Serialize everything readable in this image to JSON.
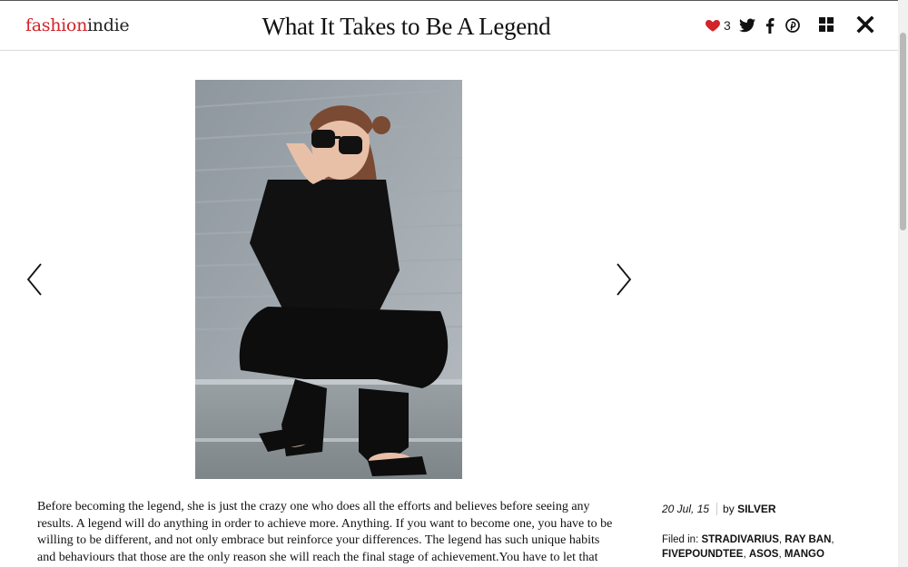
{
  "header": {
    "logo_part1": "fashion",
    "logo_part2": "indie",
    "title": "What It Takes to Be A Legend",
    "like_count": "3"
  },
  "icons": {
    "heart": "heart-icon",
    "twitter": "twitter-icon",
    "facebook": "facebook-icon",
    "pinterest": "pinterest-icon",
    "grid": "grid-icon",
    "close": "close-icon",
    "prev": "chevron-left-icon",
    "next": "chevron-right-icon"
  },
  "colors": {
    "brand_red": "#d2232a",
    "text": "#111111",
    "background": "#ffffff"
  },
  "article": {
    "body": "Before becoming the legend, she is just the crazy one who does all the efforts and believes before seeing any results. A legend will do anything in order to achieve more. Anything. If you want to become one, you have to be willing to be different, and not only embrace but reinforce your differences. The legend has such unique habits and behaviours that those are the only reason she will reach the final stage of achievement.You have to let that craziness alienate people, you"
  },
  "meta": {
    "date": "20 Jul, 15",
    "by_label": "by",
    "author": "SILVER",
    "filed_label": "Filed in:",
    "tags": [
      "STRADIVARIUS",
      "RAY BAN",
      "FIVEPOUNDTEE",
      "ASOS",
      "MANGO"
    ]
  }
}
